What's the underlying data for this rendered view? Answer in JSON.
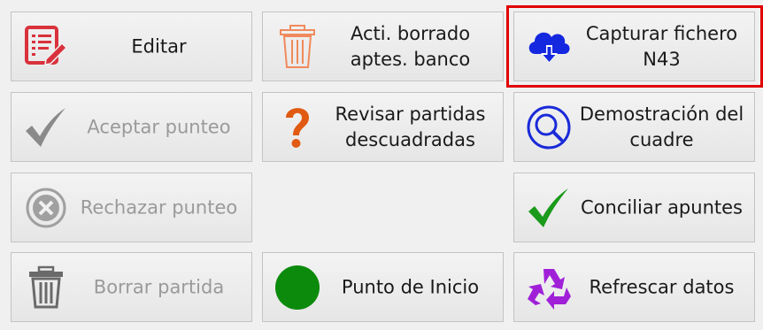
{
  "buttons": {
    "editar": {
      "label": "Editar",
      "icon": "edit-document-icon",
      "color": "#d9323c",
      "enabled": true
    },
    "acti_borrado": {
      "line1": "Acti. borrado",
      "line2": "aptes. banco",
      "icon": "trash-icon",
      "color": "#f08a5c",
      "enabled": true
    },
    "capturar": {
      "line1": "Capturar fichero",
      "line2": "N43",
      "icon": "cloud-download-icon",
      "color": "#1428e0",
      "enabled": true,
      "selected": true
    },
    "aceptar": {
      "label": "Aceptar punteo",
      "icon": "checkmark-icon",
      "color": "#8a8a8a",
      "enabled": false
    },
    "revisar": {
      "line1": "Revisar partidas",
      "line2": "descuadradas",
      "icon": "question-mark-icon",
      "color": "#e05a12",
      "enabled": true
    },
    "demostracion": {
      "line1": "Demostración del",
      "line2": "cuadre",
      "icon": "magnifier-icon",
      "color": "#1a2ad8",
      "enabled": true
    },
    "rechazar": {
      "label": "Rechazar punteo",
      "icon": "cancel-circle-icon",
      "color": "#a0a0a0",
      "enabled": false
    },
    "conciliar": {
      "label": "Conciliar apuntes",
      "icon": "checkmark-icon",
      "color": "#1a9a1a",
      "enabled": true
    },
    "borrar": {
      "label": "Borrar partida",
      "icon": "trash-icon",
      "color": "#6a6a6a",
      "enabled": false
    },
    "punto_inicio": {
      "label": "Punto de Inicio",
      "icon": "green-circle-icon",
      "color": "#0c8a0c",
      "enabled": true
    },
    "refrescar": {
      "label": "Refrescar datos",
      "icon": "recycle-icon",
      "color": "#a020d8",
      "enabled": true
    }
  }
}
